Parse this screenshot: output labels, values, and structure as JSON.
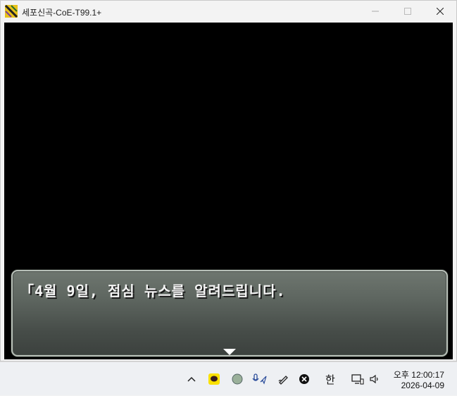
{
  "window": {
    "title": "세포신곡-CoE-T99.1+"
  },
  "game": {
    "message": "「4월 9일, 점심 뉴스를 알려드립니다."
  },
  "taskbar": {
    "ime_indicator": "한",
    "clock_time": "오후 12:00:17",
    "clock_date": "2026-04-09"
  },
  "colors": {
    "game_bg": "#000000",
    "kakao_yellow": "#fae100"
  }
}
